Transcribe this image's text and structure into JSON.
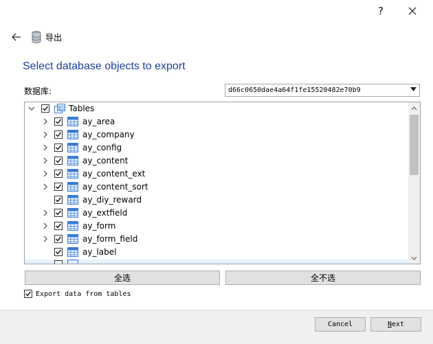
{
  "window": {
    "help_label": "?",
    "close_label": "close"
  },
  "nav": {
    "title": "导出"
  },
  "heading": "Select database objects to export",
  "database": {
    "label": "数据库:",
    "selected": "d66c0650dae4a64f1fe15520482e70b9"
  },
  "tree": {
    "root": {
      "label": "Tables",
      "checked": true,
      "expanded": true
    },
    "items": [
      {
        "label": "ay_area",
        "checked": true,
        "expandable": true
      },
      {
        "label": "ay_company",
        "checked": true,
        "expandable": true
      },
      {
        "label": "ay_config",
        "checked": true,
        "expandable": true
      },
      {
        "label": "ay_content",
        "checked": true,
        "expandable": true
      },
      {
        "label": "ay_content_ext",
        "checked": true,
        "expandable": true
      },
      {
        "label": "ay_content_sort",
        "checked": true,
        "expandable": true
      },
      {
        "label": "ay_diy_reward",
        "checked": true,
        "expandable": false
      },
      {
        "label": "ay_extfield",
        "checked": true,
        "expandable": true
      },
      {
        "label": "ay_form",
        "checked": true,
        "expandable": true
      },
      {
        "label": "ay_form_field",
        "checked": true,
        "expandable": true
      },
      {
        "label": "ay_label",
        "checked": true,
        "expandable": false
      }
    ]
  },
  "buttons": {
    "select_all": "全选",
    "select_none": "全不选"
  },
  "export_data": {
    "label": "Export data from tables",
    "checked": true
  },
  "footer": {
    "cancel": "Cancel",
    "next_first": "N",
    "next_rest": "ext"
  },
  "colors": {
    "heading": "#1b3f9e",
    "selection": "#e5f1fb",
    "table_icon": "#3a7bd5"
  }
}
